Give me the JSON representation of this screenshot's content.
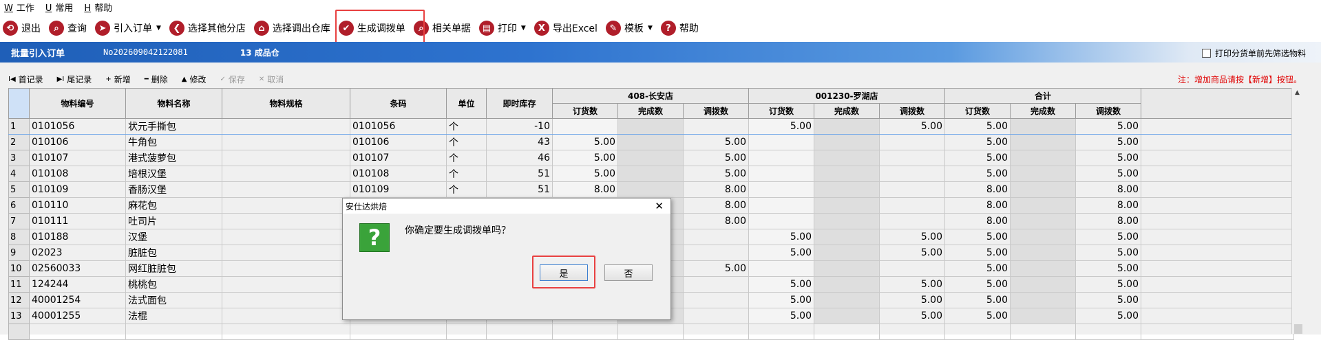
{
  "menu": [
    {
      "key": "W",
      "label": "工作"
    },
    {
      "key": "U",
      "label": "常用"
    },
    {
      "key": "H",
      "label": "帮助"
    }
  ],
  "toolbar": [
    {
      "icon": "exit-icon",
      "glyph": "⟲",
      "label": "退出",
      "dropdown": false
    },
    {
      "icon": "search-icon",
      "glyph": "⌕",
      "label": "查询",
      "dropdown": false
    },
    {
      "icon": "send-icon",
      "glyph": "➤",
      "label": "引入订单",
      "dropdown": true
    },
    {
      "icon": "back-icon",
      "glyph": "❮",
      "label": "选择其他分店",
      "dropdown": false
    },
    {
      "icon": "home-icon",
      "glyph": "⌂",
      "label": "选择调出仓库",
      "dropdown": false
    },
    {
      "icon": "check-icon",
      "glyph": "✔",
      "label": "生成调拨单",
      "dropdown": false
    },
    {
      "icon": "magnifier-icon",
      "glyph": "⌕",
      "label": "相关单据",
      "dropdown": false
    },
    {
      "icon": "printer-icon",
      "glyph": "▤",
      "label": "打印",
      "dropdown": true
    },
    {
      "icon": "excel-icon",
      "glyph": "X",
      "label": "导出Excel",
      "dropdown": false
    },
    {
      "icon": "template-icon",
      "glyph": "✎",
      "label": "模板",
      "dropdown": true
    },
    {
      "icon": "help-icon",
      "glyph": "?",
      "label": "帮助",
      "dropdown": false
    }
  ],
  "header": {
    "title": "批量引入订单",
    "order_no": "No202609042122081",
    "warehouse": "13 成品仓",
    "print_filter_label": "打印分货单前先筛选物料"
  },
  "subtoolbar": [
    {
      "glyph": "I◀",
      "label": "首记录",
      "disabled": false
    },
    {
      "glyph": "▶I",
      "label": "尾记录",
      "disabled": false
    },
    {
      "glyph": "+",
      "label": "新增",
      "disabled": false
    },
    {
      "glyph": "━",
      "label": "删除",
      "disabled": false
    },
    {
      "glyph": "▲",
      "label": "修改",
      "disabled": false
    },
    {
      "glyph": "✓",
      "label": "保存",
      "disabled": true
    },
    {
      "glyph": "✕",
      "label": "取消",
      "disabled": true
    }
  ],
  "note": "注：增加商品请按【新增】按钮。",
  "table": {
    "columns": [
      "物料编号",
      "物料名称",
      "物料规格",
      "条码",
      "单位",
      "即时库存"
    ],
    "groups": [
      "408-长安店",
      "001230-罗湖店",
      "合计"
    ],
    "sub_columns": [
      "订货数",
      "完成数",
      "调拨数"
    ],
    "rows": [
      {
        "n": "1",
        "code": "0101056",
        "name": "状元手撕包",
        "spec": "",
        "barcode": "0101056",
        "unit": "个",
        "stock": "-10",
        "g1": [
          "",
          "",
          ""
        ],
        "g2": [
          "5.00",
          "",
          "5.00"
        ],
        "g3": [
          "5.00",
          "",
          "5.00"
        ]
      },
      {
        "n": "2",
        "code": "010106",
        "name": "牛角包",
        "spec": "",
        "barcode": "010106",
        "unit": "个",
        "stock": "43",
        "g1": [
          "5.00",
          "",
          "5.00"
        ],
        "g2": [
          "",
          "",
          ""
        ],
        "g3": [
          "5.00",
          "",
          "5.00"
        ]
      },
      {
        "n": "3",
        "code": "010107",
        "name": "港式菠萝包",
        "spec": "",
        "barcode": "010107",
        "unit": "个",
        "stock": "46",
        "g1": [
          "5.00",
          "",
          "5.00"
        ],
        "g2": [
          "",
          "",
          ""
        ],
        "g3": [
          "5.00",
          "",
          "5.00"
        ]
      },
      {
        "n": "4",
        "code": "010108",
        "name": "培根汉堡",
        "spec": "",
        "barcode": "010108",
        "unit": "个",
        "stock": "51",
        "g1": [
          "5.00",
          "",
          "5.00"
        ],
        "g2": [
          "",
          "",
          ""
        ],
        "g3": [
          "5.00",
          "",
          "5.00"
        ]
      },
      {
        "n": "5",
        "code": "010109",
        "name": "香肠汉堡",
        "spec": "",
        "barcode": "010109",
        "unit": "个",
        "stock": "51",
        "g1": [
          "8.00",
          "",
          "8.00"
        ],
        "g2": [
          "",
          "",
          ""
        ],
        "g3": [
          "8.00",
          "",
          "8.00"
        ]
      },
      {
        "n": "6",
        "code": "010110",
        "name": "麻花包",
        "spec": "",
        "barcode": "",
        "unit": "",
        "stock": "",
        "g1": [
          "",
          "",
          "8.00"
        ],
        "g2": [
          "",
          "",
          ""
        ],
        "g3": [
          "8.00",
          "",
          "8.00"
        ]
      },
      {
        "n": "7",
        "code": "010111",
        "name": "吐司片",
        "spec": "",
        "barcode": "",
        "unit": "",
        "stock": "",
        "g1": [
          "",
          "",
          "8.00"
        ],
        "g2": [
          "",
          "",
          ""
        ],
        "g3": [
          "8.00",
          "",
          "8.00"
        ]
      },
      {
        "n": "8",
        "code": "010188",
        "name": "汉堡",
        "spec": "",
        "barcode": "",
        "unit": "",
        "stock": "",
        "g1": [
          "",
          "",
          ""
        ],
        "g2": [
          "5.00",
          "",
          "5.00"
        ],
        "g3": [
          "5.00",
          "",
          "5.00"
        ]
      },
      {
        "n": "9",
        "code": "02023",
        "name": "脏脏包",
        "spec": "",
        "barcode": "",
        "unit": "",
        "stock": "",
        "g1": [
          "",
          "",
          ""
        ],
        "g2": [
          "5.00",
          "",
          "5.00"
        ],
        "g3": [
          "5.00",
          "",
          "5.00"
        ]
      },
      {
        "n": "10",
        "code": "02560033",
        "name": "网红脏脏包",
        "spec": "",
        "barcode": "",
        "unit": "",
        "stock": "",
        "g1": [
          "",
          "",
          "5.00"
        ],
        "g2": [
          "",
          "",
          ""
        ],
        "g3": [
          "5.00",
          "",
          "5.00"
        ]
      },
      {
        "n": "11",
        "code": "124244",
        "name": "桃桃包",
        "spec": "",
        "barcode": "",
        "unit": "",
        "stock": "",
        "g1": [
          "",
          "",
          ""
        ],
        "g2": [
          "5.00",
          "",
          "5.00"
        ],
        "g3": [
          "5.00",
          "",
          "5.00"
        ]
      },
      {
        "n": "12",
        "code": "40001254",
        "name": "法式面包",
        "spec": "",
        "barcode": "",
        "unit": "",
        "stock": "",
        "g1": [
          "",
          "",
          ""
        ],
        "g2": [
          "5.00",
          "",
          "5.00"
        ],
        "g3": [
          "5.00",
          "",
          "5.00"
        ]
      },
      {
        "n": "13",
        "code": "40001255",
        "name": "法棍",
        "spec": "",
        "barcode": "",
        "unit": "",
        "stock": "",
        "g1": [
          "",
          "",
          ""
        ],
        "g2": [
          "5.00",
          "",
          "5.00"
        ],
        "g3": [
          "5.00",
          "",
          "5.00"
        ]
      }
    ]
  },
  "dialog": {
    "title": "安仕达烘焙",
    "message": "你确定要生成调拨单吗？",
    "yes_label": "是",
    "no_label": "否",
    "icon": "question-icon",
    "icon_glyph": "?"
  }
}
